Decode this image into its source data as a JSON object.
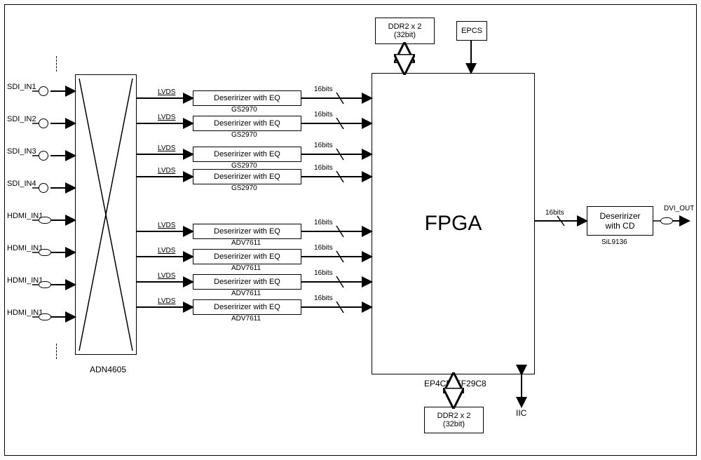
{
  "inputs": [
    {
      "name": "sdi1",
      "label": "SDI_IN1",
      "type": "circle"
    },
    {
      "name": "sdi2",
      "label": "SDI_IN2",
      "type": "circle"
    },
    {
      "name": "sdi3",
      "label": "SDI_IN3",
      "type": "circle"
    },
    {
      "name": "sdi4",
      "label": "SDI_IN4",
      "type": "circle"
    },
    {
      "name": "hdmi1",
      "label": "HDMI_IN1",
      "type": "oval"
    },
    {
      "name": "hdmi2",
      "label": "HDMI_IN1",
      "type": "oval"
    },
    {
      "name": "hdmi3",
      "label": "HDMI_IN1",
      "type": "oval"
    },
    {
      "name": "hdmi4",
      "label": "HDMI_IN1",
      "type": "oval"
    }
  ],
  "crosspoint": {
    "name": "crosspoint-switch",
    "label_below": "ADN4605"
  },
  "deserializers_sdi": {
    "label": "Deseririzer with EQ",
    "sublabel": "GS2970",
    "channel_label": "LVDS",
    "bus_label": "16bits",
    "count": 4
  },
  "deserializers_hdmi": {
    "label": "Deseririzer with EQ",
    "sublabel": "ADV7611",
    "channel_label": "LVDS",
    "bus_label": "16bits",
    "count": 4
  },
  "ddr2_top": {
    "line1": "DDR2 x 2",
    "line2": "(32bit)"
  },
  "ddr2_bottom": {
    "line1": "DDR2 x 2",
    "line2": "(32bit)"
  },
  "epcs": {
    "label": "EPCS"
  },
  "iic": {
    "label": "IIC"
  },
  "fpga": {
    "label": "FPGA",
    "sublabel": "EP4CE75F29C8",
    "out_bus": "16bits"
  },
  "output_des": {
    "line1": "Deseririzer",
    "line2": "with CD",
    "sublabel": "SiL9136"
  },
  "dvi_out": {
    "label": "DVI_OUT"
  }
}
